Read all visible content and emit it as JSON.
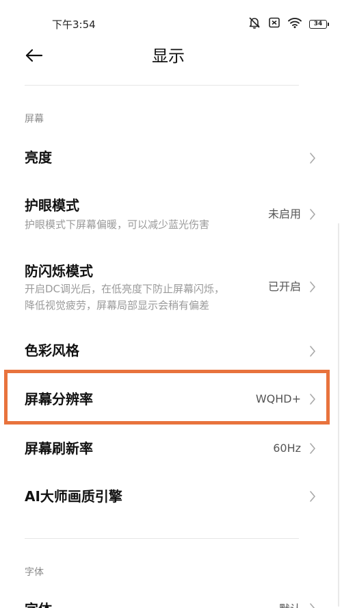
{
  "status_bar": {
    "time": "下午3:54",
    "battery": "34",
    "icons": [
      "bell-muted-icon",
      "sim-x-icon",
      "wifi-icon",
      "battery-icon"
    ]
  },
  "header": {
    "back_icon": "arrow-left-icon",
    "title": "显示"
  },
  "sections": {
    "screen": "屏幕",
    "font": "字体"
  },
  "items": [
    {
      "title": "亮度",
      "subtitle": "",
      "value": ""
    },
    {
      "title": "护眼模式",
      "subtitle": "护眼模式下屏幕偏暖，可以减少蓝光伤害",
      "value": "未启用"
    },
    {
      "title": "防闪烁模式",
      "subtitle": "开启DC调光后，在低亮度下防止屏幕闪烁，",
      "subtitle2": "降低视觉疲劳，屏幕局部显示会稍有偏差",
      "value": "已开启"
    },
    {
      "title": "色彩风格",
      "subtitle": "",
      "value": ""
    },
    {
      "title": "屏幕分辨率",
      "subtitle": "",
      "value": "WQHD+"
    },
    {
      "title": "屏幕刷新率",
      "subtitle": "",
      "value": "60Hz"
    },
    {
      "title": "AI大师画质引擎",
      "subtitle": "",
      "value": ""
    },
    {
      "title": "字体",
      "subtitle": "",
      "value": "默认"
    }
  ],
  "colors": {
    "highlight": "#e8733d",
    "secondary_text": "#9a9a9a",
    "section_text": "#8a8a8a"
  }
}
